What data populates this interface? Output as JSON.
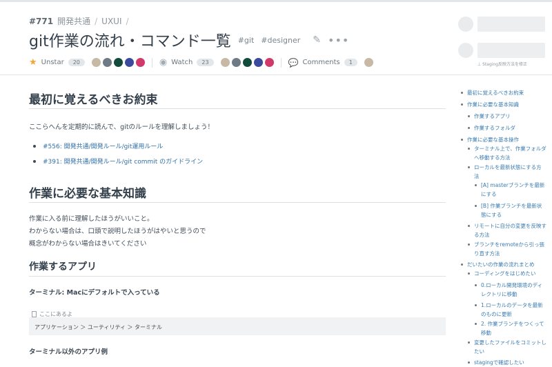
{
  "breadcrumb": {
    "number": "#771",
    "project": "開発共通",
    "category": "UXUI",
    "sep": "/"
  },
  "title": "git作業の流れ・コマンド一覧",
  "tags": [
    "#git",
    "#designer"
  ],
  "actions": {
    "edit_icon": "pencil-icon",
    "more_label": "•••"
  },
  "meta": {
    "unstar_label": "Unstar",
    "star_count": "20",
    "watch_label": "Watch",
    "watch_count": "23",
    "comments_label": "Comments",
    "comments_count": "1",
    "star_avatars": [
      "#c8b9a5",
      "#6e7a84",
      "#124a3c",
      "#3a4a9c",
      "#d03a6a"
    ],
    "watch_avatars": [
      "#c8b9a5",
      "#6e7a84",
      "#124a3c",
      "#3a4a9c",
      "#d03a6a"
    ],
    "comment_avatars": [
      "#c8b9a5"
    ]
  },
  "side_note": "⊥ Staging反映方法を修正",
  "content": {
    "h1_promise": "最初に覚えるべきお約束",
    "intro": "ここらへんを定期的に読んで、gitのルールを理解しましょう！",
    "links": [
      "#556: 開発共通/開発ルール/git運用ルール",
      "#391: 開発共通/開発ルール/git commit のガイドライン"
    ],
    "h1_knowledge": "作業に必要な基本知識",
    "knowledge_lines": [
      "作業に入る前に理解したほうがいいこと。",
      "わからない場合は、口頭で説明したほうがはやいと思うので",
      "概念がわからない場合はきいてください"
    ],
    "h2_app": "作業するアプリ",
    "h4_terminal": "ターミナル: Macにデフォルトで入っている",
    "code_label": "ここにあるよ",
    "code_text": "アプリケーション ＞ ユーティリティ ＞ ターミナル",
    "h4_other": "ターミナル以外のアプリ例"
  },
  "toc": [
    "最初に覚えるべきお約束",
    "作業に必要な基本知識",
    "作業するアプリ",
    "作業するフォルダ",
    "作業に必要な基本操作",
    "ターミナル上で、作業フォルダへ移動する方法",
    "ローカルを最新状態にする方法",
    "[A] masterブランチを最新にする",
    "[B] 作業ブランチを最新状態にする",
    "リモートに自分の変更を反映する方法",
    "ブランチをremoteから引っ張り直す方法",
    "だいたいの作業の流れまとめ",
    "コーディングをはじめたい",
    "0.ローカル開発環境のディレクトリに移動",
    "1.ローカルのデータを最新のものに更新",
    "2. 作業ブランチをつくって移動",
    "変更したファイルをコミットしたい",
    "stagingで確認したい"
  ]
}
